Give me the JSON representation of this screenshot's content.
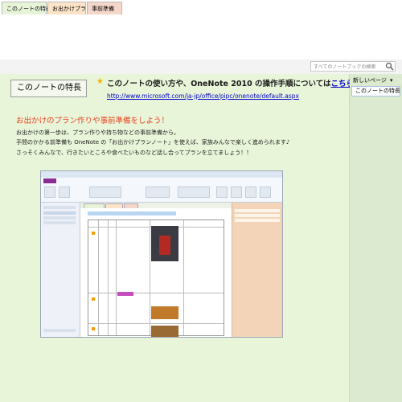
{
  "tabs": [
    {
      "label": "このノートの特長"
    },
    {
      "label": "お出かけプラン"
    },
    {
      "label": "事前準備"
    }
  ],
  "search": {
    "placeholder": "すべてのノートブックの検索 (Ctrl+E)"
  },
  "page": {
    "section_title": "このノートの特長",
    "heading_prefix": "このノートの使い方や、OneNote 2010 の操作手順については",
    "heading_link": "こちら",
    "heading_suffix": "から",
    "url": "http://www.microsoft.com/ja-jp/office/pipc/onenote/default.aspx",
    "plan_heading": "お出かけのプラン作りや事前準備をしよう！",
    "body_lines": [
      "お出かけの第一歩は、プラン作りや持ち物などの事前準備から。",
      "手間のかかる前準備も OneNote の「お出かけプランノート」を使えば、家族みんなで楽しく進められます♪",
      "さっそくみんなで、行きたいところや食べたいものなど話し合ってプランを立てましょう！！"
    ]
  },
  "page_panel": {
    "new_page_label": "新しいページ",
    "pages": [
      {
        "label": "このノートの特長"
      }
    ]
  },
  "colors": {
    "page_bg": "#e8f5d9",
    "accent_heading": "#e8431f",
    "link": "#0000cc",
    "onenote_purple": "#8a2c91"
  },
  "icons": {
    "star": "star-icon",
    "search": "search-icon",
    "chevron": "chevron-down-icon"
  }
}
